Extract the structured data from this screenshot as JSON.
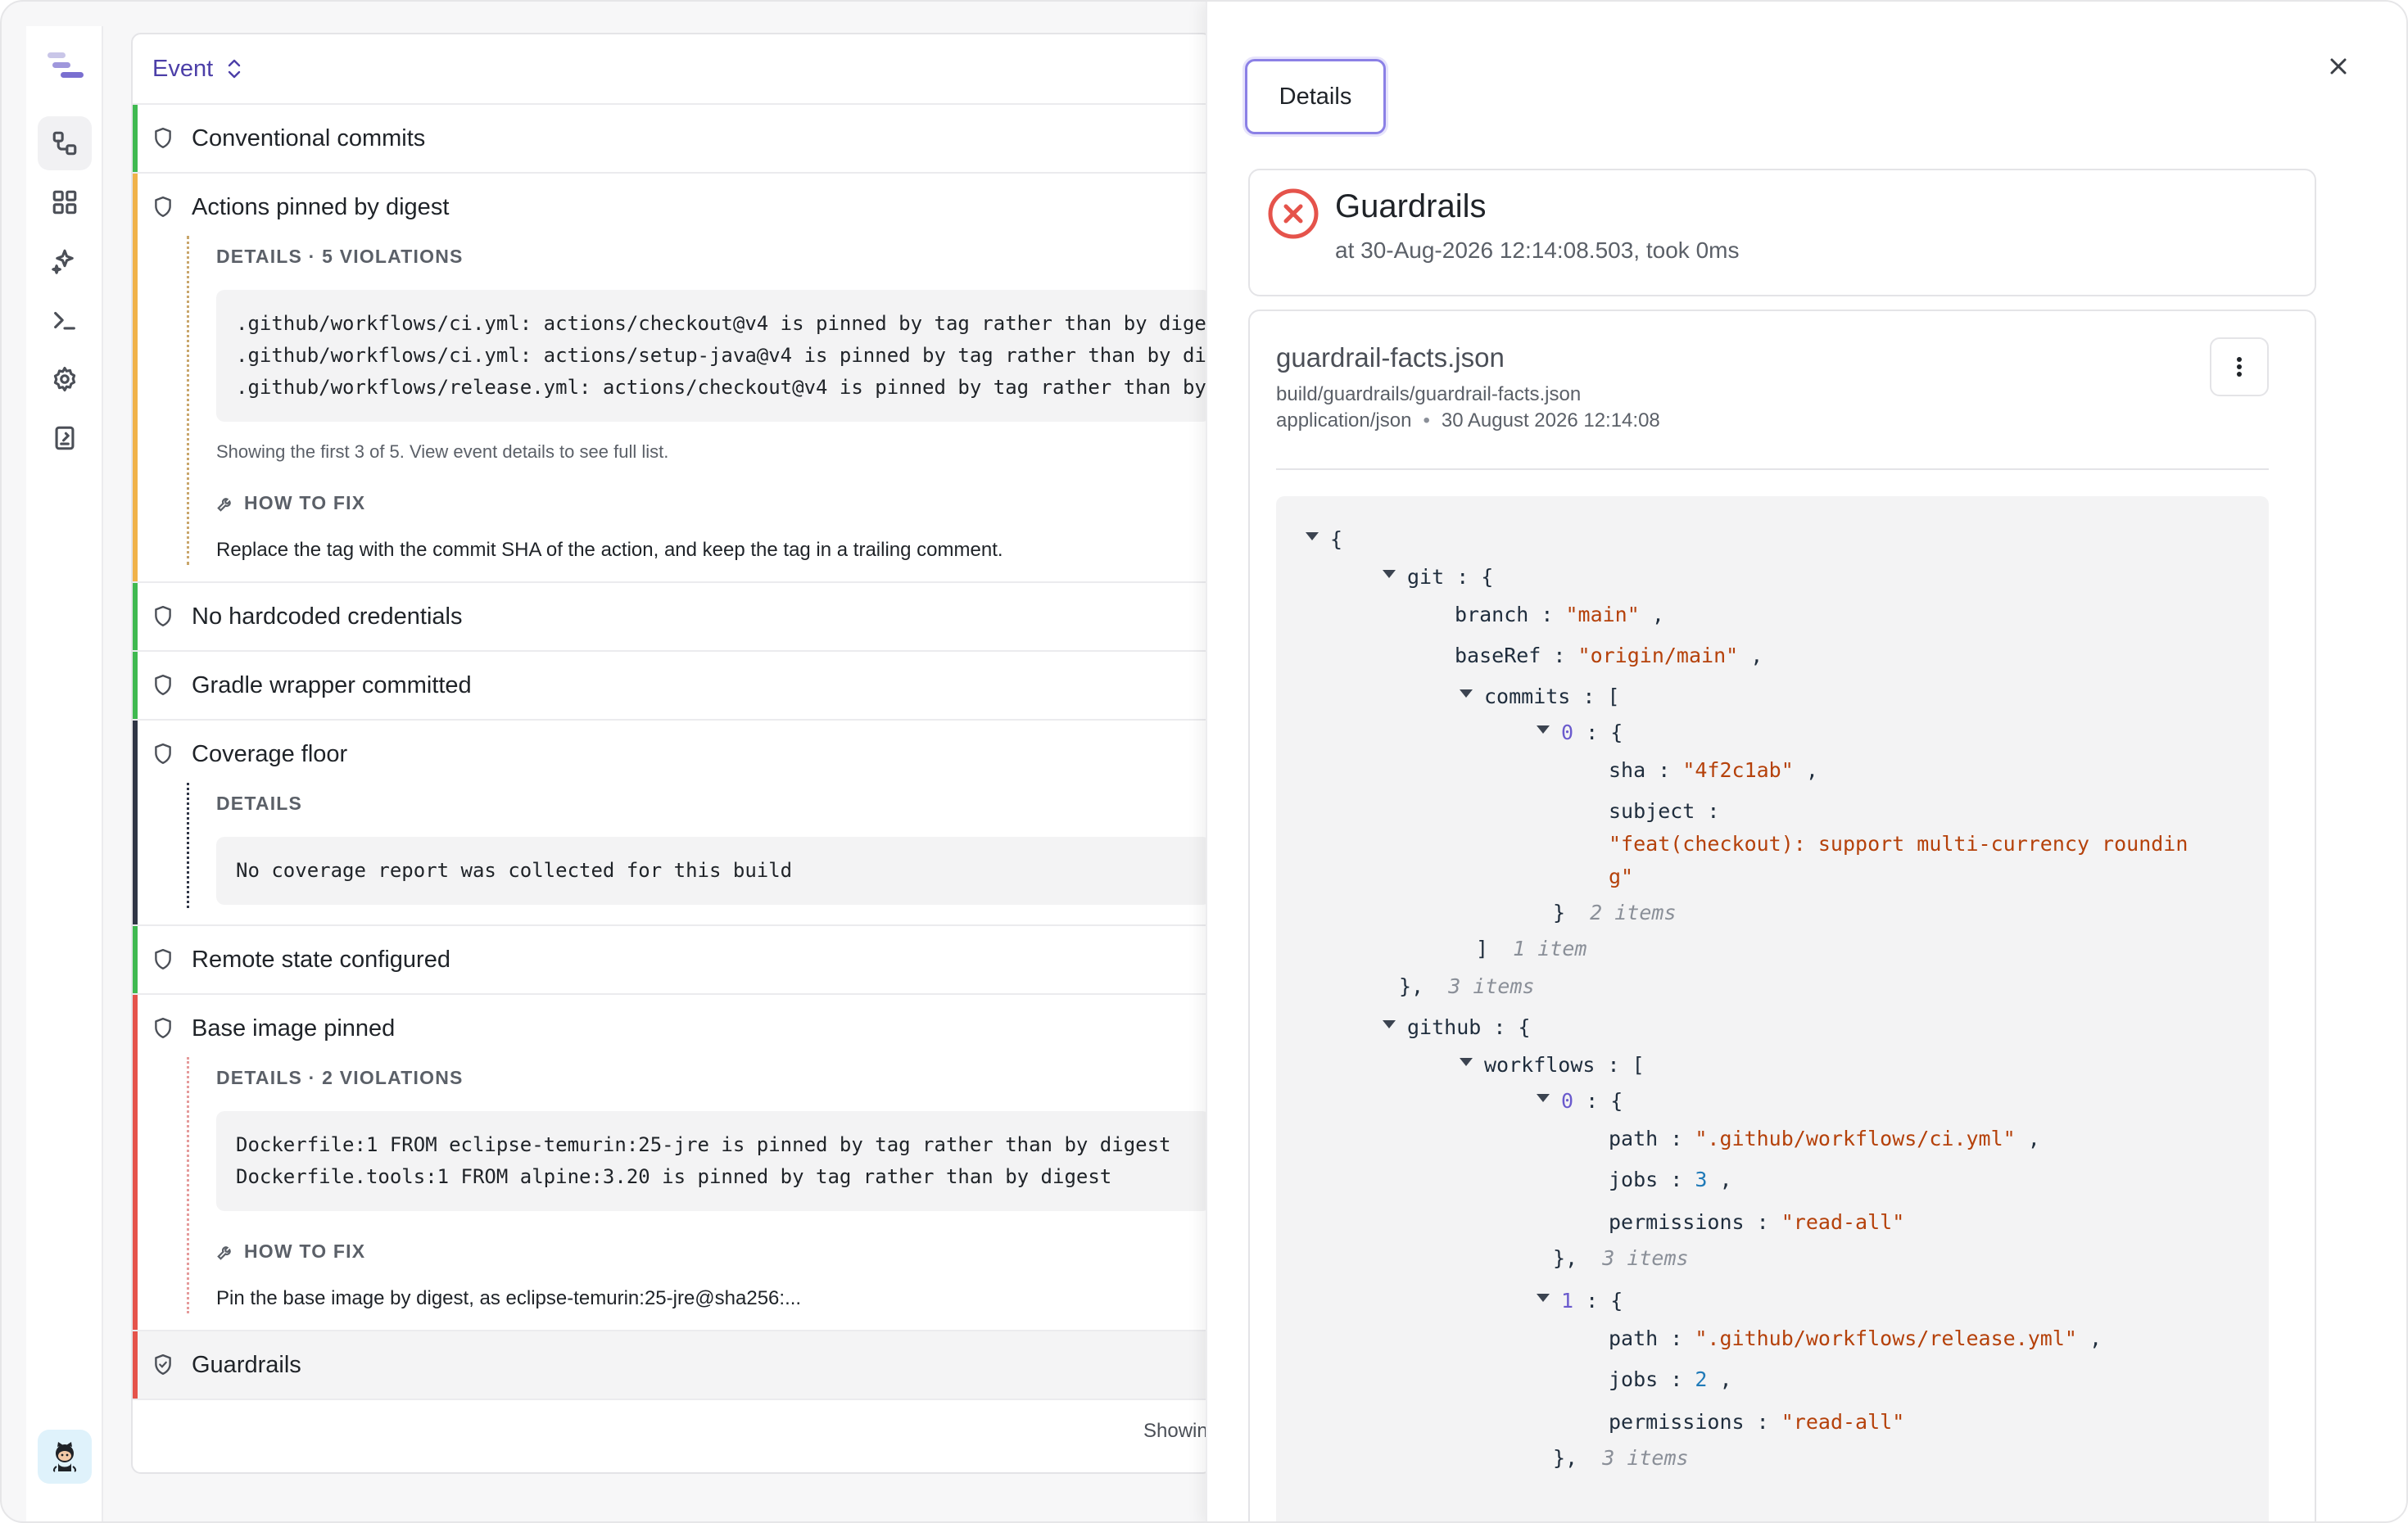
{
  "events": {
    "header": "Event",
    "items": [
      {
        "title": "Conventional commits",
        "color": "#3fb950"
      },
      {
        "title": "Actions pinned by digest",
        "color": "#f0b24a",
        "details_label": "DETAILS · 5 VIOLATIONS",
        "code": ".github/workflows/ci.yml: actions/checkout@v4 is pinned by tag rather than by dige\n.github/workflows/ci.yml: actions/setup-java@v4 is pinned by tag rather than by di\n.github/workflows/release.yml: actions/checkout@v4 is pinned by tag rather than by",
        "note": "Showing the first 3 of 5. View event details to see full list.",
        "fix_label": "HOW TO FIX",
        "fix": "Replace the tag with the commit SHA of the action, and keep the tag in a trailing comment."
      },
      {
        "title": "No hardcoded credentials",
        "color": "#3fb950"
      },
      {
        "title": "Gradle wrapper committed",
        "color": "#3fb950"
      },
      {
        "title": "Coverage floor",
        "color": "#2f3545",
        "details_label": "DETAILS",
        "code": "No coverage report was collected for this build"
      },
      {
        "title": "Remote state configured",
        "color": "#3fb950"
      },
      {
        "title": "Base image pinned",
        "color": "#e5534b",
        "details_label": "DETAILS · 2 VIOLATIONS",
        "code": "Dockerfile:1 FROM eclipse-temurin:25-jre is pinned by tag rather than by digest\nDockerfile.tools:1 FROM alpine:3.20 is pinned by tag rather than by digest",
        "fix_label": "HOW TO FIX",
        "fix": "Pin the base image by digest, as eclipse-temurin:25-jre@sha256:..."
      },
      {
        "title": "Guardrails",
        "color": "#e5534b"
      }
    ],
    "footer": "Showin"
  },
  "drawer": {
    "tab": "Details",
    "status": {
      "title": "Guardrails",
      "subtitle": "at 30-Aug-2026 12:14:08.503, took 0ms",
      "color": "#e5534b"
    },
    "file": {
      "name": "guardrail-facts.json",
      "path": "build/guardrails/guardrail-facts.json",
      "type": "application/json",
      "date": "30 August 2026 12:14:08"
    },
    "json": {
      "git_key": "git",
      "branch_key": "branch",
      "branch_val": "\"main\"",
      "baseRef_key": "baseRef",
      "baseRef_val": "\"origin/main\"",
      "commits_key": "commits",
      "commit0_index": "0",
      "sha_key": "sha",
      "sha_val": "\"4f2c1ab\"",
      "subject_key": "subject",
      "subject_val_1": "\"feat(checkout): support multi-currency roundin",
      "subject_val_2": "g\"",
      "items_2": "2 items",
      "item_1": "1 item",
      "items_3": "3 items",
      "github_key": "github",
      "workflows_key": "workflows",
      "wf0_index": "0",
      "wf0_path": "\".github/workflows/ci.yml\"",
      "wf0_jobs": "3",
      "wf0_perm": "\"read-all\"",
      "wf1_index": "1",
      "wf1_path": "\".github/workflows/release.yml\"",
      "wf1_jobs": "2",
      "wf1_perm": "\"read-all\"",
      "path_key": "path",
      "jobs_key": "jobs",
      "permissions_key": "permissions"
    }
  },
  "colors": {
    "accent": "#4c3fa8",
    "pass": "#3fb950",
    "warn": "#f0b24a",
    "fail": "#e5534b",
    "neutral": "#2f3545"
  },
  "rail": {
    "icons": [
      "logo-icon",
      "workflow-icon",
      "dashboard-icon",
      "sparkle-icon",
      "terminal-icon",
      "settings-icon",
      "report-icon",
      "github-avatar-icon"
    ]
  }
}
